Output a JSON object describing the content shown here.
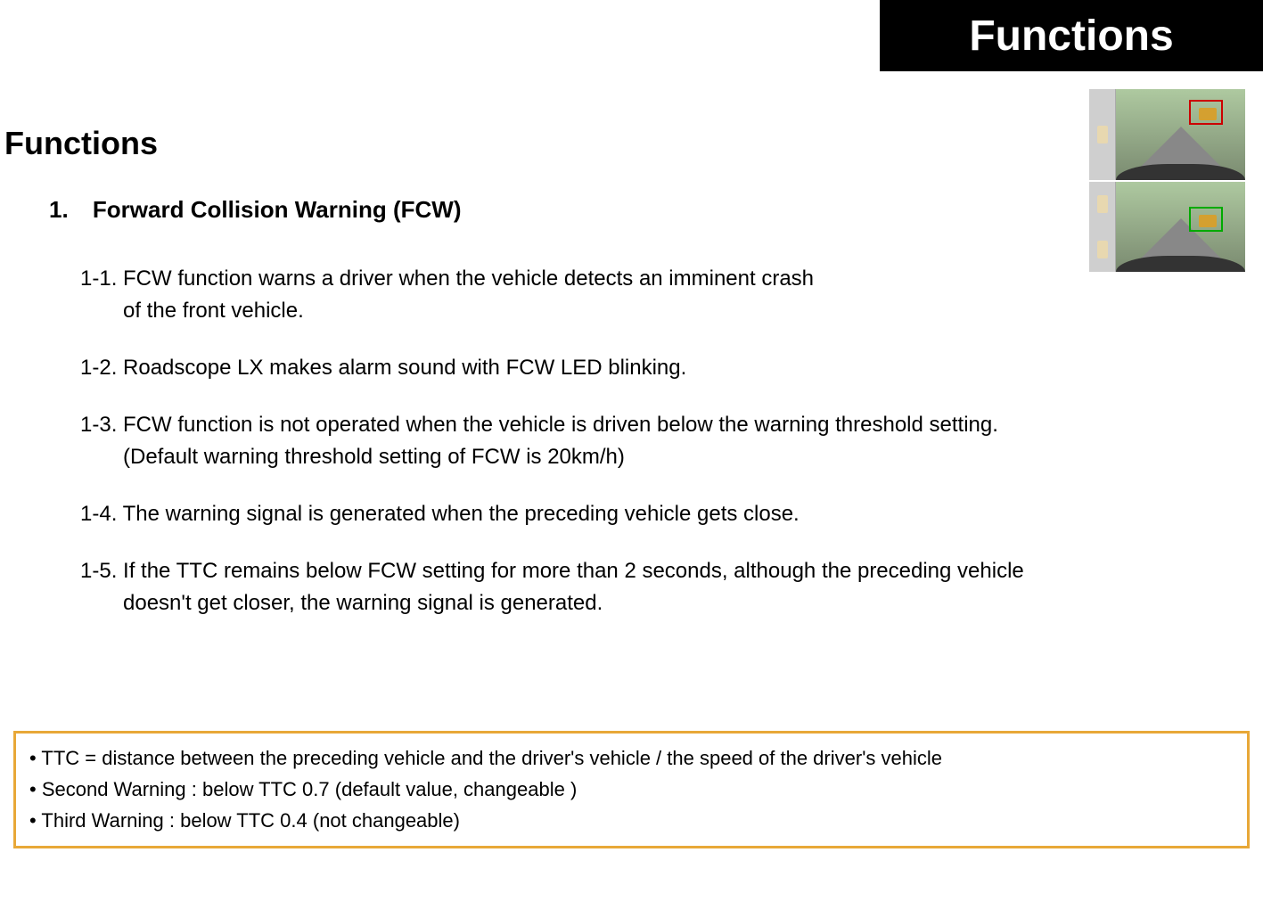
{
  "header": {
    "banner": "Functions"
  },
  "section": {
    "title": "Functions",
    "subsection_number": "1.",
    "subsection_title": "Forward Collision Warning (FCW)"
  },
  "items": {
    "item_1_1": "1-1. FCW function warns a driver when the vehicle detects an imminent crash",
    "item_1_1_cont": "of the front vehicle.",
    "item_1_2": "1-2. Roadscope LX makes alarm sound with FCW LED blinking.",
    "item_1_3": "1-3. FCW function is not operated  when the vehicle is driven below the warning threshold setting.",
    "item_1_3_cont": "(Default warning threshold setting of FCW is 20km/h)",
    "item_1_4": "1-4. The warning signal is generated when the preceding vehicle gets close.",
    "item_1_5": "1-5. If the TTC remains below FCW setting for more than 2 seconds, although the preceding vehicle",
    "item_1_5_cont": "doesn't get closer, the warning signal is generated."
  },
  "infobox": {
    "line1": "• TTC = distance between the preceding vehicle and the driver's vehicle /  the speed of the driver's vehicle",
    "line2": "• Second Warning : below TTC 0.7 (default value, changeable )",
    "line3": "• Third Warning : below TTC 0.4 (not changeable)"
  }
}
